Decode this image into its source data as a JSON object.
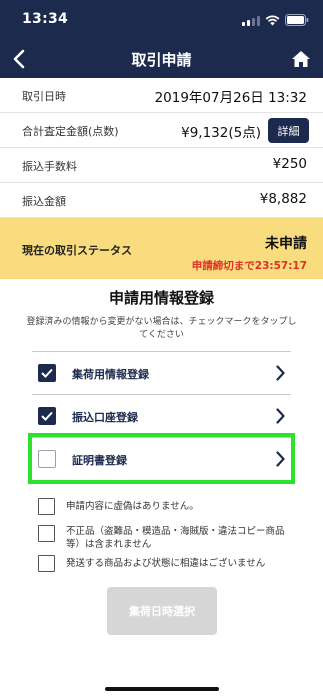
{
  "status_bar": {
    "time": "13:34"
  },
  "nav": {
    "title": "取引申請"
  },
  "info_rows": [
    {
      "label": "取引日時",
      "value": "2019年07月26日 13:32"
    },
    {
      "label": "合計査定金額(点数)",
      "value": "¥9,132(5点)",
      "button": "詳細"
    },
    {
      "label": "振込手数料",
      "value": "¥250"
    },
    {
      "label": "振込金額",
      "value": "¥8,882"
    }
  ],
  "trade_status": {
    "label": "現在の取引ステータス",
    "value": "未申請",
    "deadline": "申請締切まで23:57:17",
    "panel_color": "#f8dc7e",
    "deadline_color": "#e0302a"
  },
  "registration": {
    "title": "申請用情報登録",
    "description": "登録済みの情報から変更がない場合は、チェックマークをタップしてください",
    "items": [
      {
        "label": "集荷用情報登録",
        "checked": true
      },
      {
        "label": "振込口座登録",
        "checked": true
      },
      {
        "label": "証明書登録",
        "checked": false,
        "highlighted": true
      }
    ]
  },
  "confirmations": [
    {
      "text": "申請内容に虚偽はありません。",
      "checked": false
    },
    {
      "text": "不正品（盗難品・模造品・海賊版・違法コピー商品等）は含まれません",
      "checked": false
    },
    {
      "text": "発送する商品および状態に相違はございません",
      "checked": false
    }
  ],
  "submit": {
    "label": "集荷日時選択",
    "enabled": false
  },
  "colors": {
    "brand_navy": "#1c2a4e",
    "highlight_green": "#2ce22c",
    "disabled_gray": "#d6d6d6"
  },
  "icons": {
    "back": "chevron-left-icon",
    "home": "home-icon",
    "item_arrow": "chevron-right-icon",
    "check": "checkmark-icon"
  }
}
